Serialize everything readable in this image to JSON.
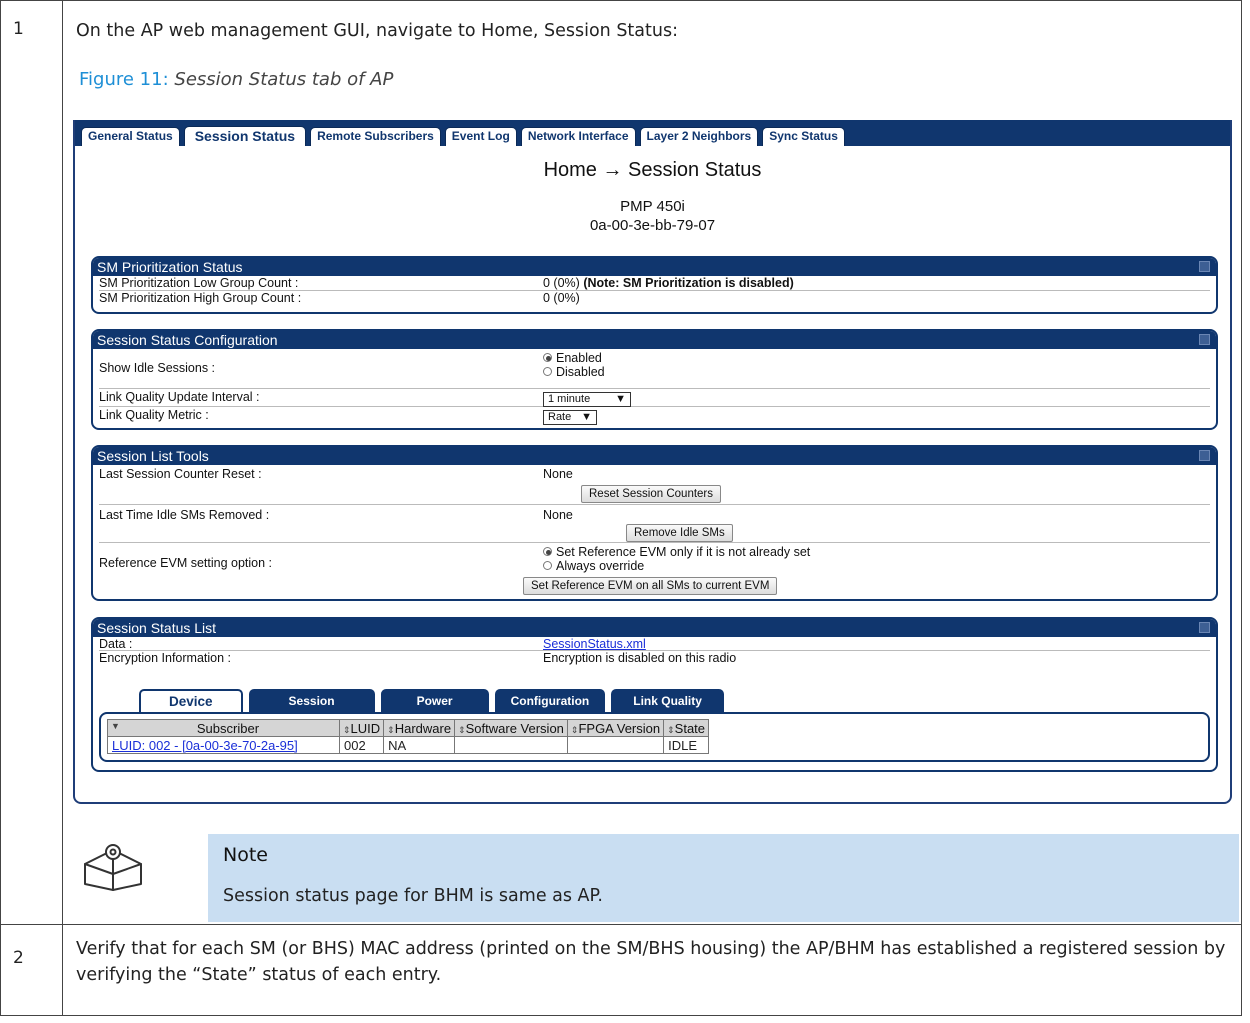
{
  "steps": [
    {
      "number": "1",
      "text": "On the AP web management GUI, navigate to Home, Session Status:"
    },
    {
      "number": "2",
      "text": "Verify that for each SM (or BHS) MAC address (printed on the SM/BHS housing) the AP/BHM has established a registered session by verifying the “State” status of each entry."
    }
  ],
  "figure": {
    "number": "Figure 11:",
    "caption": "Session Status tab of AP"
  },
  "gui": {
    "tabs": [
      "General Status",
      "Session Status",
      "Remote Subscribers",
      "Event Log",
      "Network Interface",
      "Layer 2 Neighbors",
      "Sync Status"
    ],
    "breadcrumb": "Home → Session Status",
    "device_name": "PMP 450i",
    "device_mac": "0a-00-3e-bb-79-07",
    "sm_prioritization": {
      "title": "SM Prioritization Status",
      "low_label": "SM Prioritization Low Group Count :",
      "low_value": "0 (0%)",
      "low_note": "(Note: SM Prioritization is disabled)",
      "high_label": "SM Prioritization High Group Count :",
      "high_value": "0 (0%)"
    },
    "session_config": {
      "title": "Session Status Configuration",
      "idle_label": "Show Idle Sessions :",
      "idle_enabled": "Enabled",
      "idle_disabled": "Disabled",
      "interval_label": "Link Quality Update Interval :",
      "interval_value": "1 minute",
      "metric_label": "Link Quality Metric :",
      "metric_value": "Rate"
    },
    "session_tools": {
      "title": "Session List Tools",
      "reset_label": "Last Session Counter Reset :",
      "reset_value": "None",
      "reset_button": "Reset Session Counters",
      "idle_removed_label": "Last Time Idle SMs Removed :",
      "idle_removed_value": "None",
      "remove_button": "Remove Idle SMs",
      "evm_label": "Reference EVM setting option :",
      "evm_opt1": "Set Reference EVM only if it is not already set",
      "evm_opt2": "Always override",
      "evm_button": "Set Reference EVM on all SMs to current EVM"
    },
    "session_list": {
      "title": "Session Status List",
      "data_label": "Data :",
      "data_link": "SessionStatus.xml",
      "enc_label": "Encryption Information :",
      "enc_value": "Encryption is disabled on this radio",
      "subtabs": [
        "Device",
        "Session",
        "Power",
        "Configuration",
        "Link Quality"
      ],
      "columns": [
        "Subscriber",
        "LUID",
        "Hardware",
        "Software Version",
        "FPGA Version",
        "State"
      ],
      "rows": [
        [
          "LUID: 002 - [0a-00-3e-70-2a-95]",
          "002",
          "NA",
          "",
          "",
          "IDLE"
        ]
      ]
    }
  },
  "note": {
    "title": "Note",
    "text": "Session status page for BHM is same as AP."
  }
}
